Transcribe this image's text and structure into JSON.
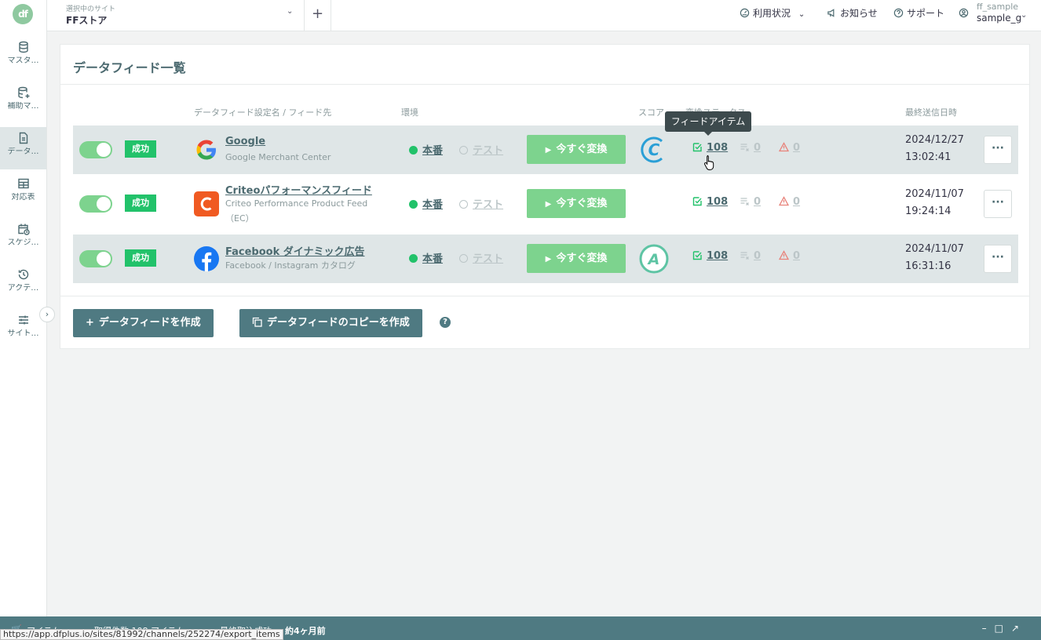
{
  "app": {
    "logo_text": "df"
  },
  "sidebar": {
    "items": [
      {
        "label": "マスタ…",
        "icon": "database-icon"
      },
      {
        "label": "補助マ…",
        "icon": "database-plus-icon"
      },
      {
        "label": "データ…",
        "icon": "document-icon",
        "active": true
      },
      {
        "label": "対応表",
        "icon": "table-icon"
      },
      {
        "label": "スケジ…",
        "icon": "calendar-clock-icon"
      },
      {
        "label": "アクテ…",
        "icon": "history-icon"
      },
      {
        "label": "サイト…",
        "icon": "sliders-icon"
      }
    ],
    "toggle_icon": "chevron-right-icon"
  },
  "header": {
    "site_label": "選択中のサイト",
    "site_name": "FFストア",
    "usage": "利用状況",
    "news": "お知らせ",
    "support": "サポート",
    "user_name": "ff_sample",
    "user_account": "sample_g"
  },
  "main": {
    "title": "データフィード一覧",
    "columns": {
      "name": "データフィード設定名 / フィード先",
      "env": "環境",
      "score": "スコア",
      "status": "変換ステータス",
      "last_sent": "最終送信日時"
    },
    "rows": [
      {
        "status_badge": "成功",
        "name": "Google",
        "destination": "Google Merchant Center",
        "env_prod": "本番",
        "env_test": "テスト",
        "convert_label": "今すぐ変換",
        "score": "C",
        "items_ok": "108",
        "items_excluded": "0",
        "items_warning": "0",
        "date": "2024/12/27",
        "time": "13:02:41",
        "more": "···"
      },
      {
        "status_badge": "成功",
        "name": "Criteoパフォーマンスフィード",
        "destination": "Criteo Performance Product Feed（EC）",
        "env_prod": "本番",
        "env_test": "テスト",
        "convert_label": "今すぐ変換",
        "score": "",
        "items_ok": "108",
        "items_excluded": "0",
        "items_warning": "0",
        "date": "2024/11/07",
        "time": "19:24:14",
        "more": "···"
      },
      {
        "status_badge": "成功",
        "name": "Facebook ダイナミック広告",
        "destination": "Facebook / Instagram カタログ",
        "env_prod": "本番",
        "env_test": "テスト",
        "convert_label": "今すぐ変換",
        "score": "A",
        "items_ok": "108",
        "items_excluded": "0",
        "items_warning": "0",
        "date": "2024/11/07",
        "time": "16:31:16",
        "more": "···"
      }
    ],
    "tooltip": "フィードアイテム",
    "create_button": "データフィードを作成",
    "copy_button": "データフィードのコピーを作成"
  },
  "bottom_bar": {
    "text_left": "アイテム",
    "text_count": "取得件数 108 アイテム",
    "text_status": "最終取込成功",
    "text_ago": "約4ヶ月前"
  },
  "status_url": "https://app.dfplus.io/sites/81992/channels/252274/export_items",
  "colors": {
    "accent": "#4f7a82",
    "success": "#22c26a",
    "toggle_on": "#7dd38e",
    "score_c": "#2a9fd6",
    "score_a": "#5ec4a4"
  }
}
